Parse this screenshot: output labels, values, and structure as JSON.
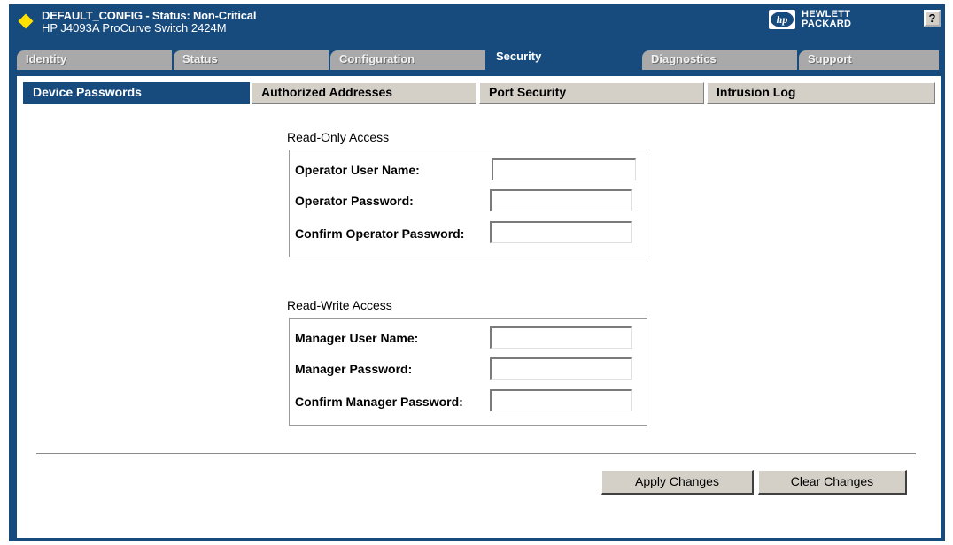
{
  "header": {
    "title": "DEFAULT_CONFIG - Status: Non-Critical",
    "subtitle": "HP J4093A ProCurve Switch 2424M",
    "logo_line1": "HEWLETT",
    "logo_line2": "PACKARD",
    "logo_mark": "hp",
    "help_label": "?",
    "status_color": "#ffe000"
  },
  "main_tabs": [
    {
      "label": "Identity"
    },
    {
      "label": "Status"
    },
    {
      "label": "Configuration"
    },
    {
      "label": "Security",
      "active": true
    },
    {
      "label": "Diagnostics"
    },
    {
      "label": "Support"
    }
  ],
  "sub_tabs": [
    {
      "label": "Device Passwords",
      "active": true
    },
    {
      "label": "Authorized Addresses"
    },
    {
      "label": "Port Security"
    },
    {
      "label": "Intrusion Log"
    }
  ],
  "read_only": {
    "title": "Read-Only Access",
    "fields": [
      {
        "label": "Operator User Name:",
        "value": ""
      },
      {
        "label": "Operator Password:",
        "value": ""
      },
      {
        "label": "Confirm Operator Password:",
        "value": ""
      }
    ]
  },
  "read_write": {
    "title": "Read-Write Access",
    "fields": [
      {
        "label": "Manager User Name:",
        "value": ""
      },
      {
        "label": "Manager Password:",
        "value": ""
      },
      {
        "label": "Confirm Manager Password:",
        "value": ""
      }
    ]
  },
  "actions": {
    "apply_label": "Apply Changes",
    "clear_label": "Clear Changes"
  },
  "colors": {
    "frame": "#174a7d",
    "inactive_tab": "#a9a9a9",
    "button_face": "#d4d0c8"
  }
}
